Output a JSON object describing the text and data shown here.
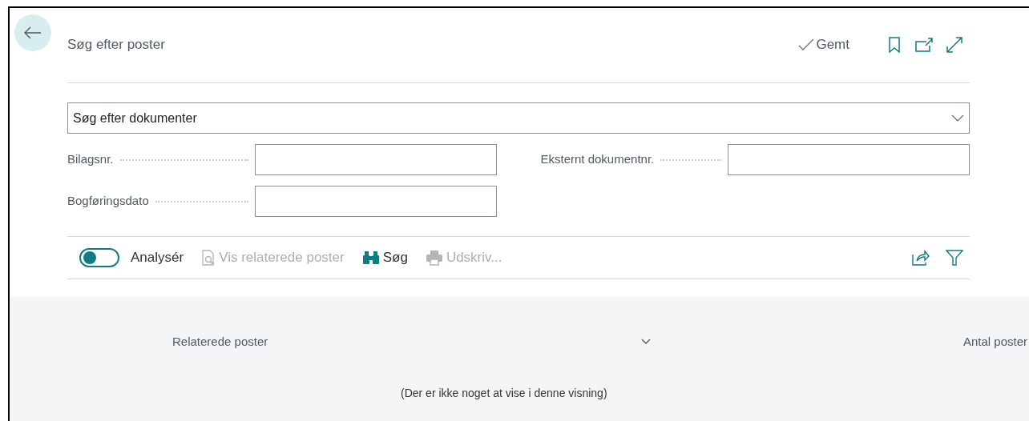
{
  "header": {
    "title": "Søg efter poster",
    "status": "Gemt"
  },
  "search_type": {
    "value": "Søg efter dokumenter"
  },
  "fields": [
    {
      "label": "Bilagsnr."
    },
    {
      "label": "Eksternt dokumentnr."
    },
    {
      "label": "Bogføringsdato"
    }
  ],
  "toolbar": {
    "toggle": {
      "label": "Analysér",
      "on": false
    },
    "actions": [
      {
        "kind": "document",
        "label": "Vis relaterede poster",
        "disabled": true
      },
      {
        "kind": "binoculars",
        "label": "Søg",
        "disabled": false
      },
      {
        "kind": "printer",
        "label": "Udskriv...",
        "disabled": true
      }
    ]
  },
  "results": {
    "columns": [
      "Relaterede poster",
      "Antal poster"
    ],
    "empty_message": "(Der er ikke noget at vise i denne visning)"
  }
}
